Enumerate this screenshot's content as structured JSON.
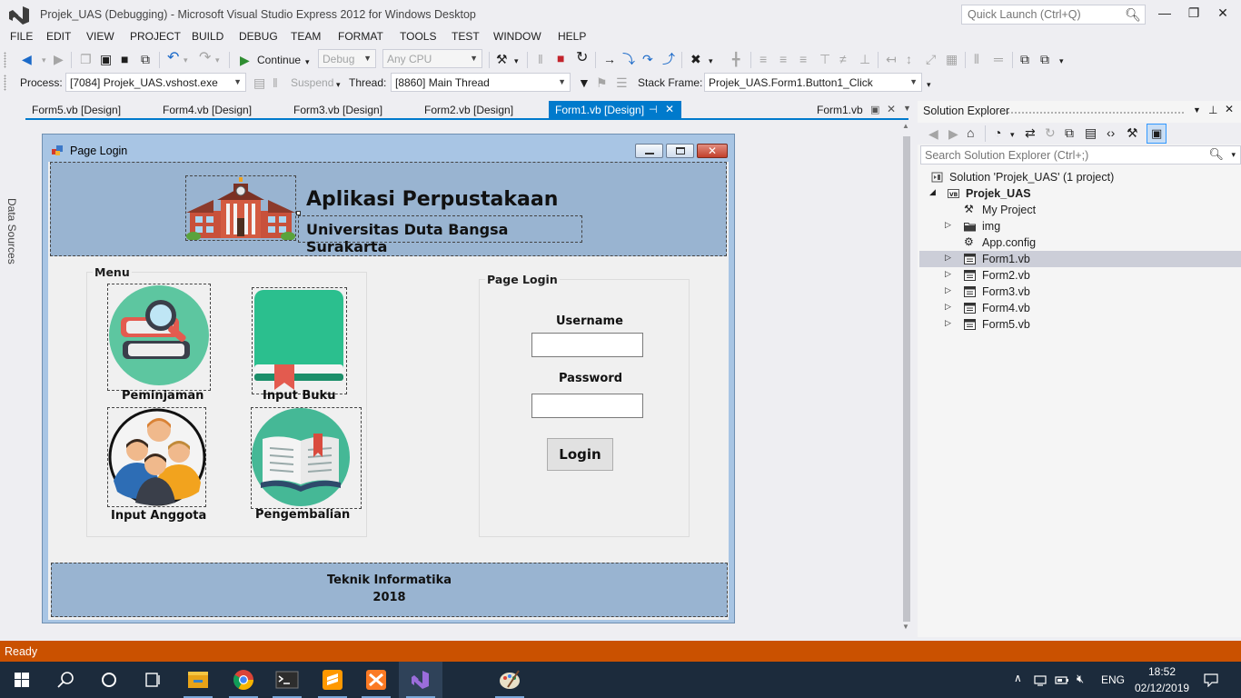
{
  "window": {
    "title": "Projek_UAS (Debugging) - Microsoft Visual Studio Express 2012 for Windows Desktop",
    "quick_launch_placeholder": "Quick Launch (Ctrl+Q)"
  },
  "menu": [
    "FILE",
    "EDIT",
    "VIEW",
    "PROJECT",
    "BUILD",
    "DEBUG",
    "TEAM",
    "FORMAT",
    "TOOLS",
    "TEST",
    "WINDOW",
    "HELP"
  ],
  "toolbar": {
    "continue_label": "Continue",
    "config": "Debug",
    "platform": "Any CPU"
  },
  "debug_location": {
    "process_label": "Process:",
    "process_value": "[7084] Projek_UAS.vshost.exe",
    "suspend_label": "Suspend",
    "thread_label": "Thread:",
    "thread_value": "[8860] Main Thread",
    "stack_frame_label": "Stack Frame:",
    "stack_frame_value": "Projek_UAS.Form1.Button1_Click"
  },
  "doc_tabs": [
    {
      "label": "Form5.vb [Design]"
    },
    {
      "label": "Form4.vb [Design]"
    },
    {
      "label": "Form3.vb [Design]"
    },
    {
      "label": "Form2.vb [Design]"
    },
    {
      "label": "Form1.vb [Design]",
      "active": true
    }
  ],
  "preview_tab": "Form1.vb",
  "side_tab": "Data Sources",
  "form": {
    "title": "Page Login",
    "app_title": "Aplikasi Perpustakaan",
    "university": "Universitas Duta Bangsa Surakarta",
    "menu_group": "Menu",
    "menu_items": [
      "Peminjaman",
      "Input Buku",
      "Input Anggota",
      "Pengembalian"
    ],
    "login_group": "Page Login",
    "username_label": "Username",
    "password_label": "Password",
    "login_button": "Login",
    "footer_line1": "Teknik Informatika",
    "footer_line2": "2018"
  },
  "solution_explorer": {
    "title": "Solution Explorer",
    "search_placeholder": "Search Solution Explorer (Ctrl+;)",
    "items": [
      {
        "label": "Solution 'Projek_UAS' (1 project)",
        "icon": "solution-icon"
      },
      {
        "label": "Projek_UAS",
        "icon": "vb-project-icon",
        "bold": true
      },
      {
        "label": "My Project",
        "icon": "wrench-icon"
      },
      {
        "label": "img",
        "icon": "folder-icon"
      },
      {
        "label": "App.config",
        "icon": "config-file-icon"
      },
      {
        "label": "Form1.vb",
        "icon": "form-file-icon",
        "selected": true
      },
      {
        "label": "Form2.vb",
        "icon": "form-file-icon"
      },
      {
        "label": "Form3.vb",
        "icon": "form-file-icon"
      },
      {
        "label": "Form4.vb",
        "icon": "form-file-icon"
      },
      {
        "label": "Form5.vb",
        "icon": "form-file-icon"
      }
    ]
  },
  "status": "Ready",
  "taskbar": {
    "language": "ENG",
    "time": "18:52",
    "date": "02/12/2019"
  },
  "colors": {
    "accent": "#007acc",
    "status_bar": "#ca5100",
    "form_panel": "#99b4d1",
    "taskbar": "#1c2b3c"
  }
}
